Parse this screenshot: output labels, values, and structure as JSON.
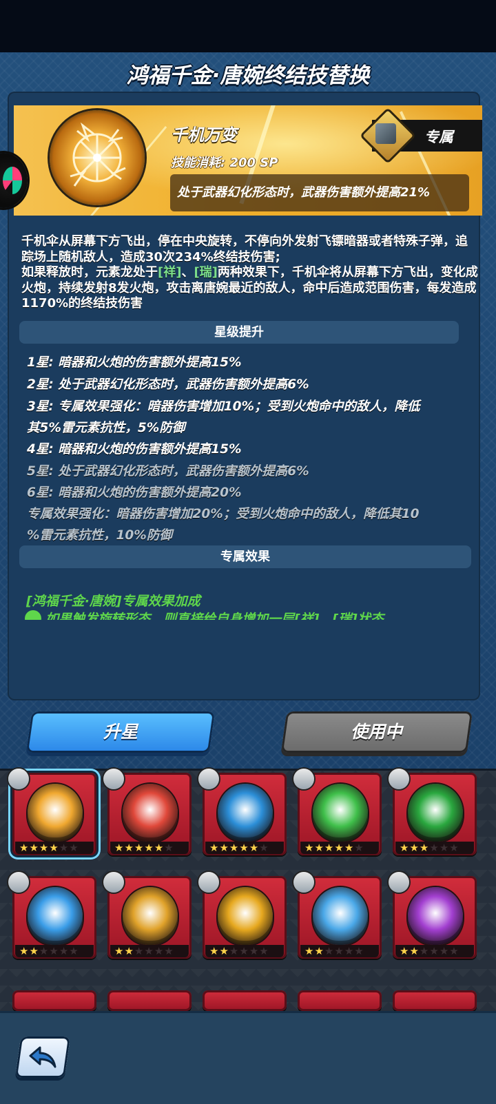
{
  "header": {
    "title": "鸿福千金·唐婉终结技替换"
  },
  "skill": {
    "name": "千机万变",
    "cost": "技能消耗: 200 SP",
    "effect": "处于武器幻化形态时，武器伤害额外提高21%",
    "exclusive_label": "专属",
    "emblem_icon": "umbrella-pinwheel-icon"
  },
  "description": {
    "p1": "千机伞从屏幕下方飞出，停在中央旋转，不停向外发射飞镖暗器或者特殊子弹，追踪场上随机敌人，造成30次234%终结技伤害;",
    "p2_a": "如果释放时，元素龙处于",
    "tag1": "[祥]",
    "p2_b": "、",
    "tag2": "[瑞]",
    "p2_c": "两种效果下，千机伞将从屏幕下方飞出，变化成火炮，持续发射8发火炮，攻击离唐婉最近的敌人，命中后造成范围伤害，每发造成1170%的终结技伤害"
  },
  "star_section": {
    "title": "星级提升",
    "lines": [
      "1星: 暗器和火炮的伤害额外提高15%",
      "2星: 处于武器幻化形态时，武器伤害额外提高6%",
      "3星: 专属效果强化：暗器伤害增加10%；受到火炮命中的敌人，降低",
      "其5%雷元素抗性，5%防御",
      "4星: 暗器和火炮的伤害额外提高15%",
      "5星: 处于武器幻化形态时，武器伤害额外提高6%",
      "6星: 暗器和火炮的伤害额外提高20%",
      "专属效果强化：暗器伤害增加20%；受到火炮命中的敌人，降低其10",
      "%雷元素抗性，10%防御"
    ]
  },
  "exclusive_section": {
    "title": "专属效果",
    "bonus_title": "[鸿福千金·唐婉]专属效果加成",
    "bonus_line": "如果触发旋转形态，则直接给自身增加一层[祥]、[瑞]状态"
  },
  "buttons": {
    "upgrade": "升星",
    "in_use": "使用中"
  },
  "colors": {
    "accent_blue": "#3aa2f5",
    "card_red": "#c42133",
    "green_text": "#5fd64b",
    "gold": "#f3b23a"
  },
  "skill_cards": [
    {
      "icon": "umbrella-pinwheel-icon",
      "stars": 4,
      "color": "#f0a830",
      "selected": true
    },
    {
      "icon": "flame-sword-icon",
      "stars": 5,
      "color": "#e0483a"
    },
    {
      "icon": "yin-yang-icon",
      "stars": 5,
      "color": "#2c8fd8"
    },
    {
      "icon": "green-beam-icon",
      "stars": 5,
      "color": "#3fbf4a"
    },
    {
      "icon": "dragon-head-icon",
      "stars": 3,
      "color": "#2aa83f"
    },
    {
      "icon": "castle-icon",
      "stars": 2,
      "color": "#3a9de8"
    },
    {
      "icon": "golden-orb-icon",
      "stars": 2,
      "color": "#e0a22a"
    },
    {
      "icon": "lightning-burst-icon",
      "stars": 2,
      "color": "#e6a81f"
    },
    {
      "icon": "ice-claw-icon",
      "stars": 2,
      "color": "#4aa8e8"
    },
    {
      "icon": "purple-cauldron-icon",
      "stars": 2,
      "color": "#a23fd0"
    }
  ],
  "footer": {
    "back_icon": "back-arrow-icon"
  }
}
